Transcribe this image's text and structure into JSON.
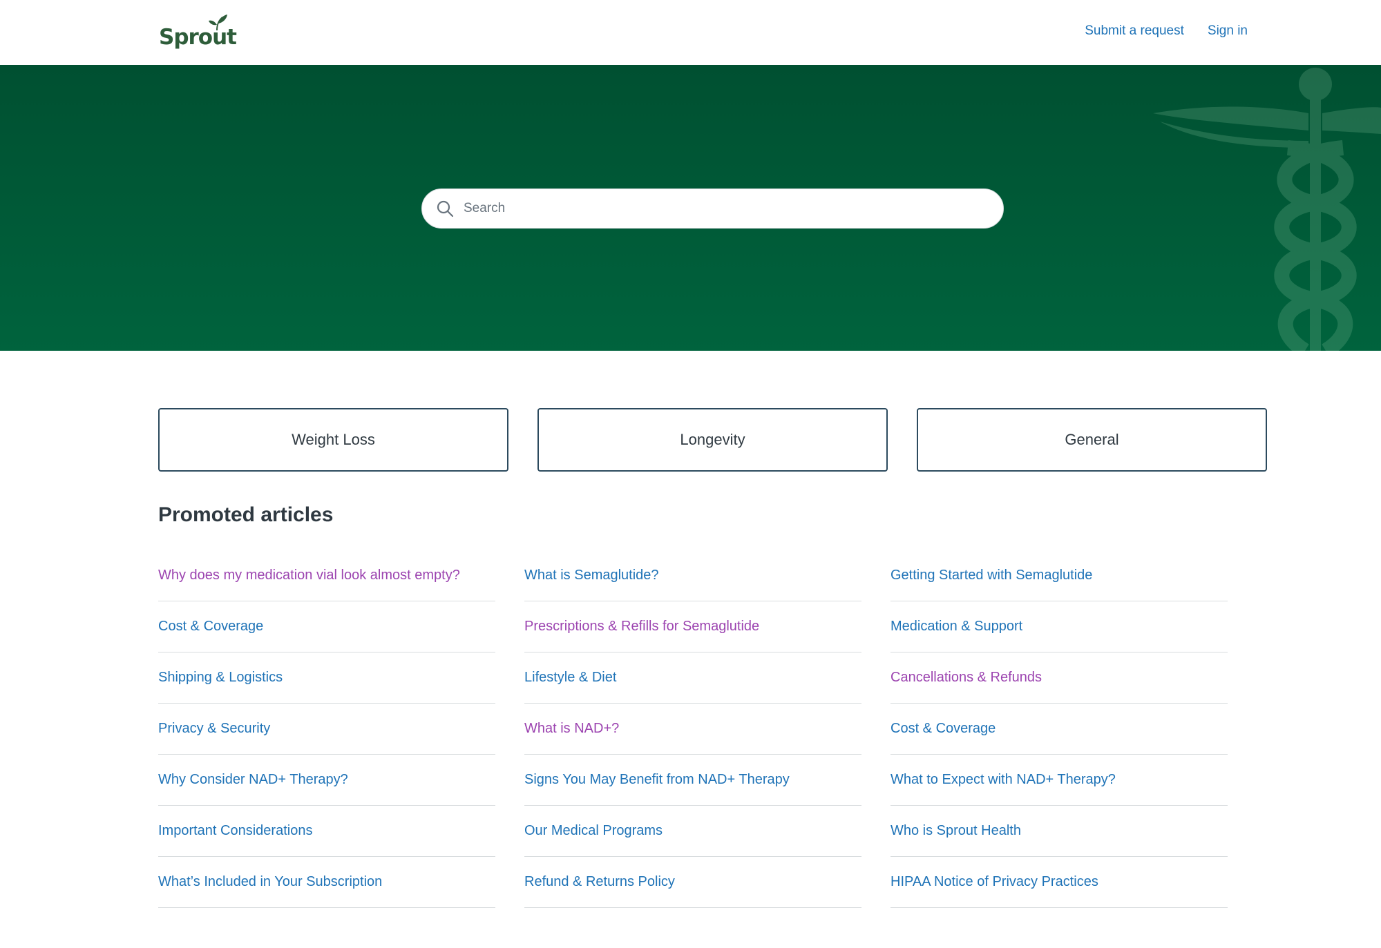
{
  "header": {
    "logo_text": "Sprout",
    "nav": {
      "submit_request": "Submit a request",
      "sign_in": "Sign in"
    }
  },
  "hero": {
    "search": {
      "placeholder": "Search",
      "value": ""
    }
  },
  "categories": [
    "Weight Loss",
    "Longevity",
    "General"
  ],
  "promoted": {
    "title": "Promoted articles",
    "columns": [
      [
        "Why does my medication vial look almost empty?",
        "Cost & Coverage",
        "Shipping & Logistics",
        "Privacy & Security",
        "Why Consider NAD+ Therapy?",
        "Important Considerations",
        "What’s Included in Your Subscription"
      ],
      [
        "What is Semaglutide?",
        "Prescriptions & Refills for Semaglutide",
        "Lifestyle & Diet",
        "What is NAD+?",
        "Signs You May Benefit from NAD+ Therapy",
        "Our Medical Programs",
        "Refund & Returns Policy"
      ],
      [
        "Getting Started with Semaglutide",
        "Medication & Support",
        "Cancellations & Refunds",
        "Cost & Coverage",
        "What to Expect with NAD+ Therapy?",
        "Who is Sprout Health",
        "HIPAA Notice of Privacy Practices"
      ]
    ]
  },
  "colors": {
    "brand_green": "#005031",
    "link": "#1f73b7",
    "visited_link": "#9c44b0"
  }
}
